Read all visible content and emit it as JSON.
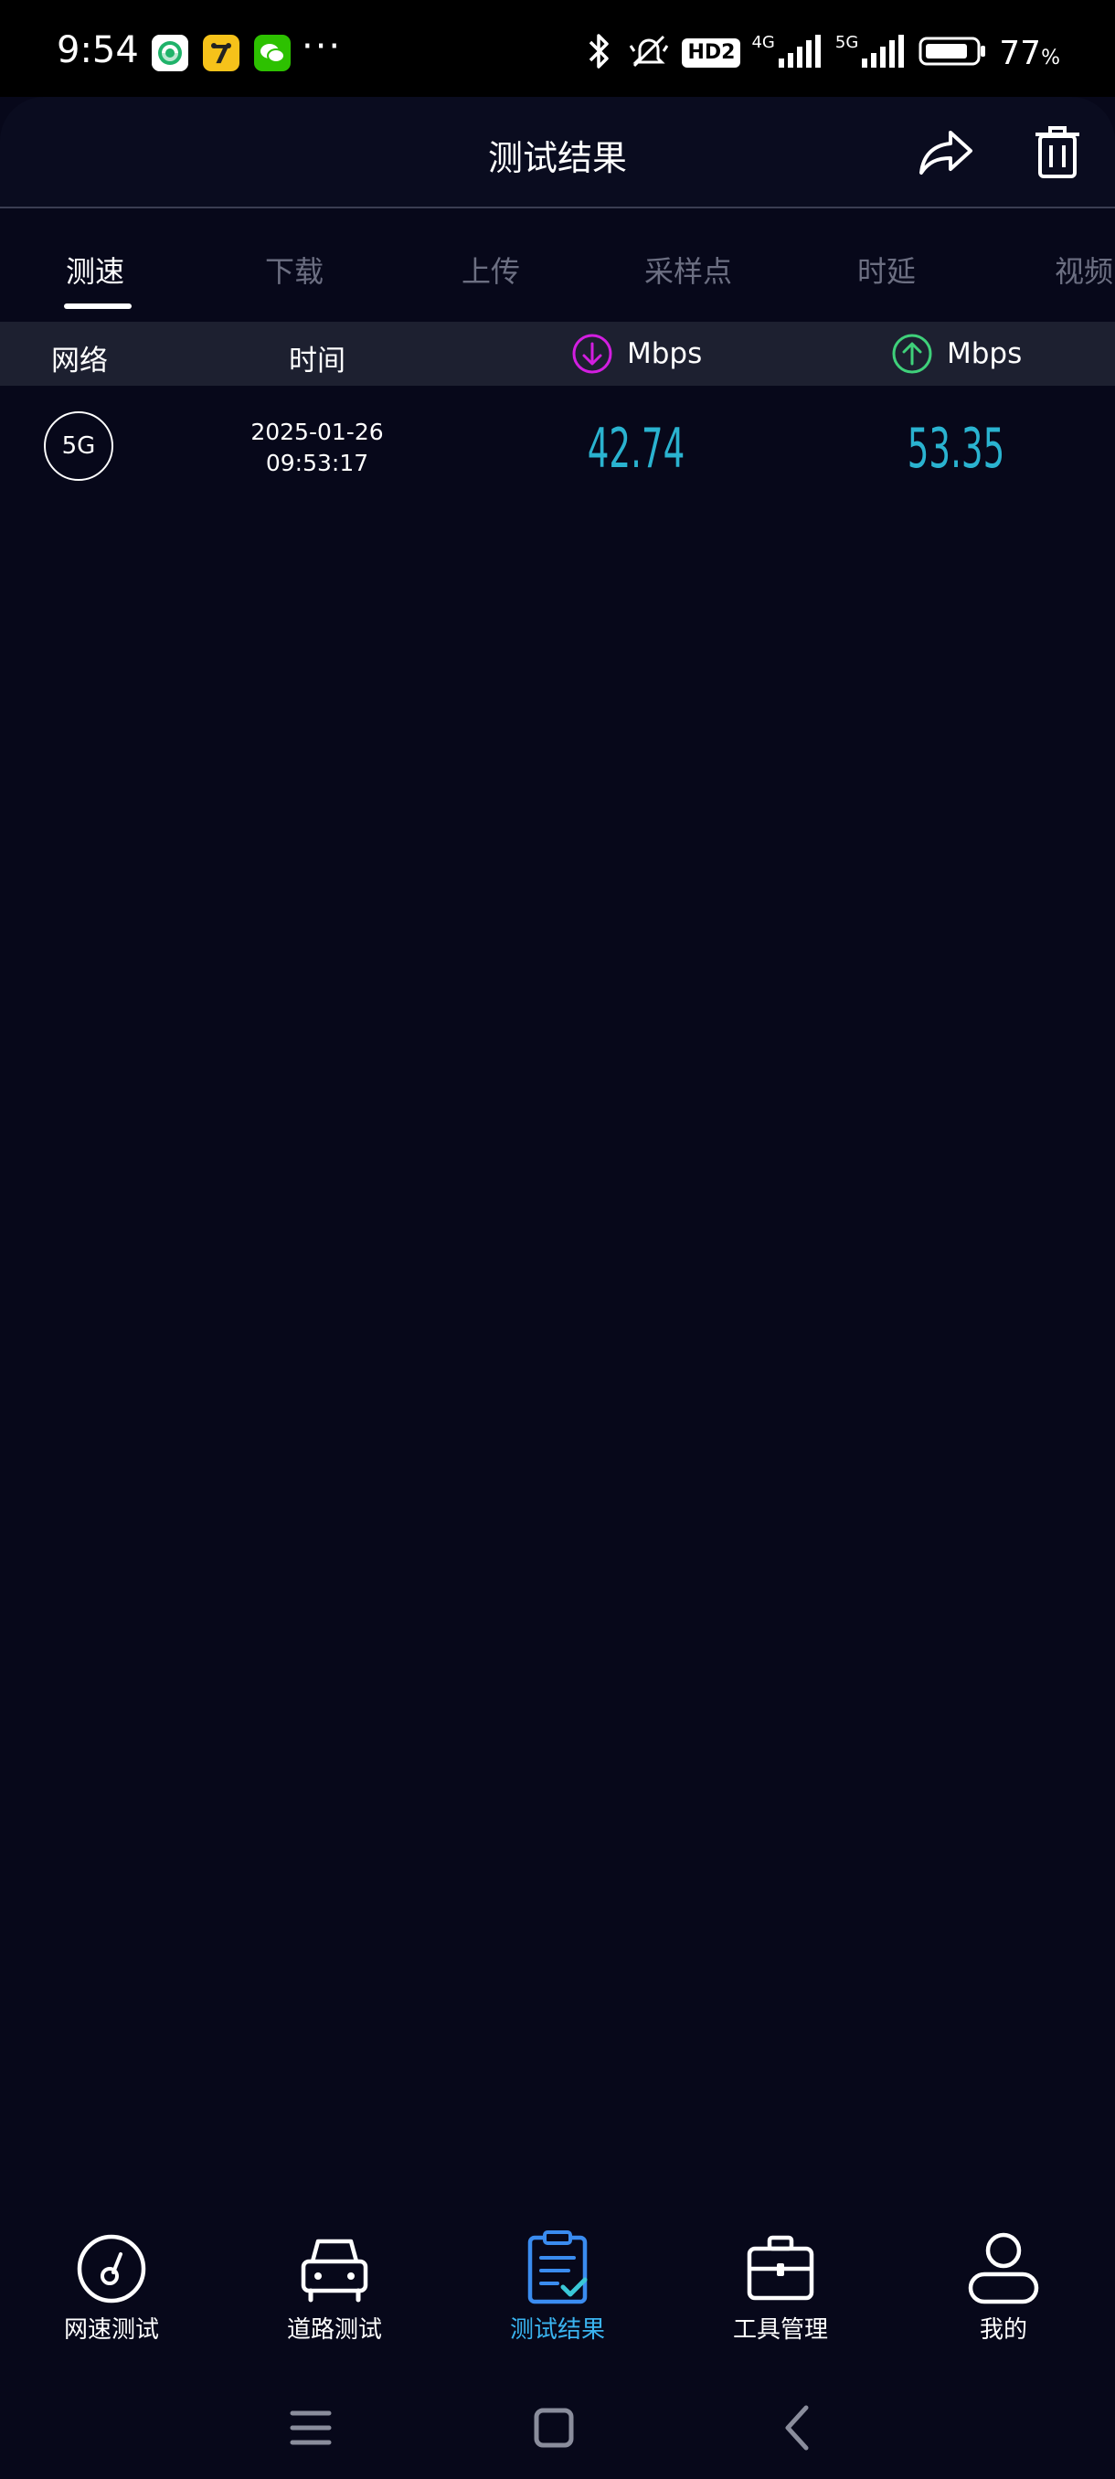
{
  "status_bar": {
    "time": "9:54",
    "more_icons": "···",
    "hd_badge": "HD2",
    "net1": "4G",
    "net2": "5G",
    "battery_percent": "77",
    "battery_unit": "%"
  },
  "header": {
    "title": "测试结果",
    "icons": [
      "share-icon",
      "trash-icon"
    ]
  },
  "tabs": [
    {
      "label": "测速",
      "active": true
    },
    {
      "label": "下载",
      "active": false
    },
    {
      "label": "上传",
      "active": false
    },
    {
      "label": "采样点",
      "active": false
    },
    {
      "label": "时延",
      "active": false
    },
    {
      "label": "视频",
      "active": false
    }
  ],
  "columns": {
    "network": "网络",
    "time": "时间",
    "download_unit": "Mbps",
    "upload_unit": "Mbps"
  },
  "results": [
    {
      "network": "5G",
      "date": "2025-01-26",
      "time": "09:53:17",
      "download": "42.74",
      "upload": "53.35"
    }
  ],
  "colors": {
    "background": "#07081a",
    "accent": "#3ab4f0",
    "speed_value": "#2ab3d0",
    "download_icon": "#d21ee0",
    "upload_icon": "#3fd07a"
  },
  "bottom_nav": [
    {
      "label": "网速测试",
      "icon": "speedometer-icon",
      "active": false
    },
    {
      "label": "道路测试",
      "icon": "car-icon",
      "active": false
    },
    {
      "label": "测试结果",
      "icon": "clipboard-check-icon",
      "active": true
    },
    {
      "label": "工具管理",
      "icon": "toolbox-icon",
      "active": false
    },
    {
      "label": "我的",
      "icon": "user-icon",
      "active": false
    }
  ]
}
